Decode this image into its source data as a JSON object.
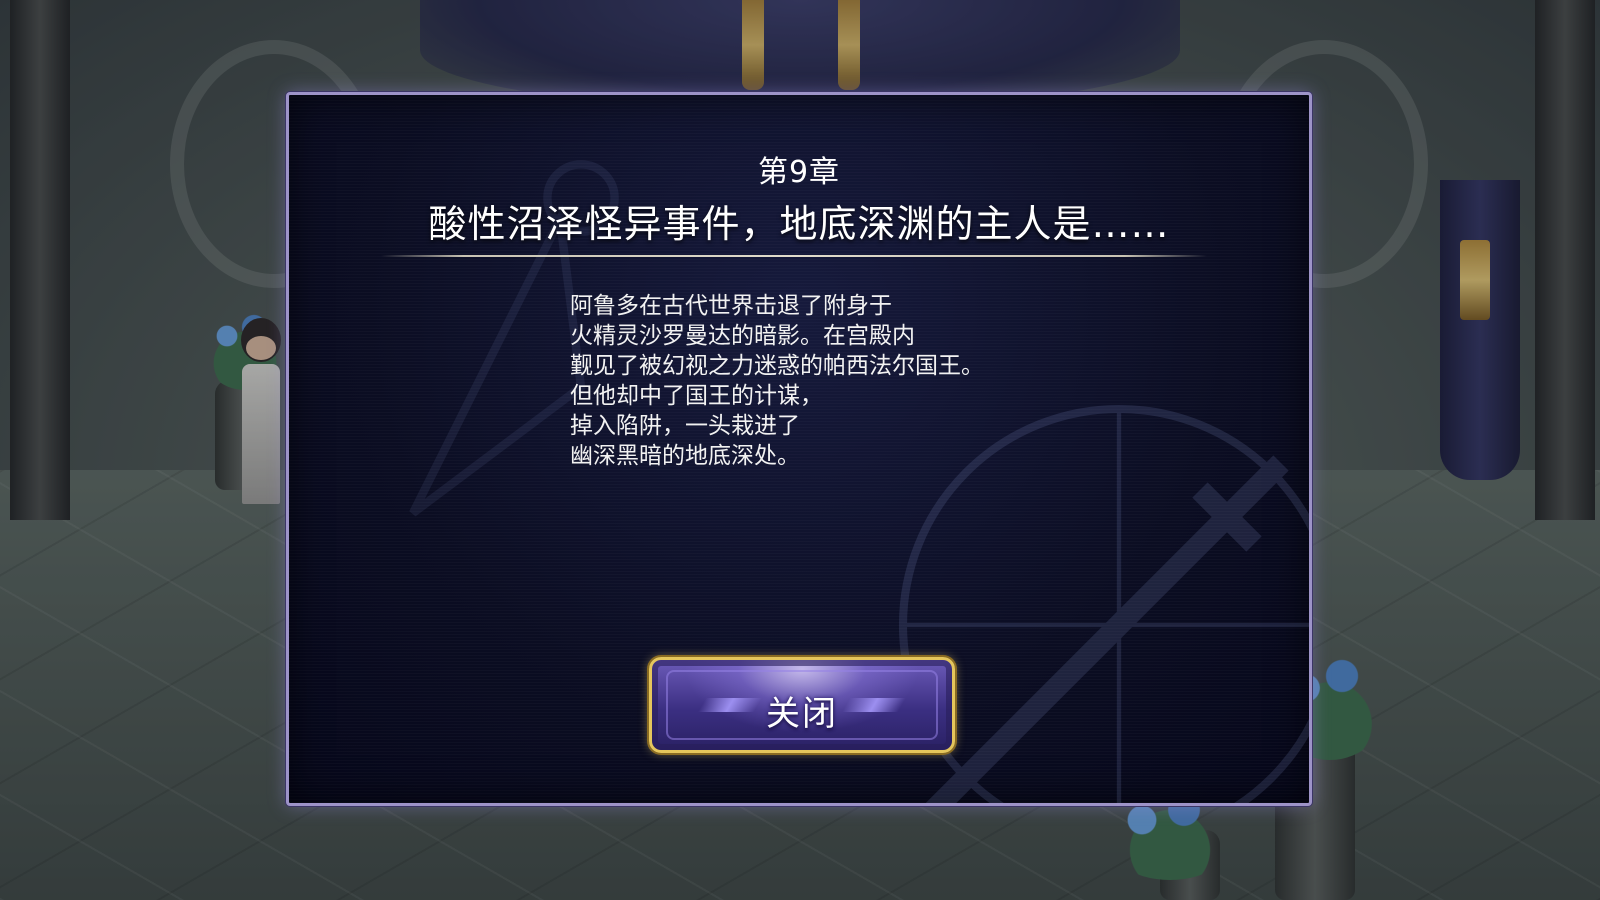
{
  "dialog": {
    "chapter": "第9章",
    "title": "酸性沼泽怪异事件，地底深渊的主人是……",
    "story_lines": [
      "阿鲁多在古代世界击退了附身于",
      "火精灵沙罗曼达的暗影。在宫殿内",
      "觐见了被幻视之力迷惑的帕西法尔国王。",
      "但他却中了国王的计谋，",
      "掉入陷阱，一头栽进了",
      "幽深黑暗的地底深处。"
    ],
    "close_label": "关闭"
  },
  "colors": {
    "dialog_border": "#9d93c8",
    "button_border": "#e5c65c",
    "button_fill": "#4a3c9c"
  }
}
